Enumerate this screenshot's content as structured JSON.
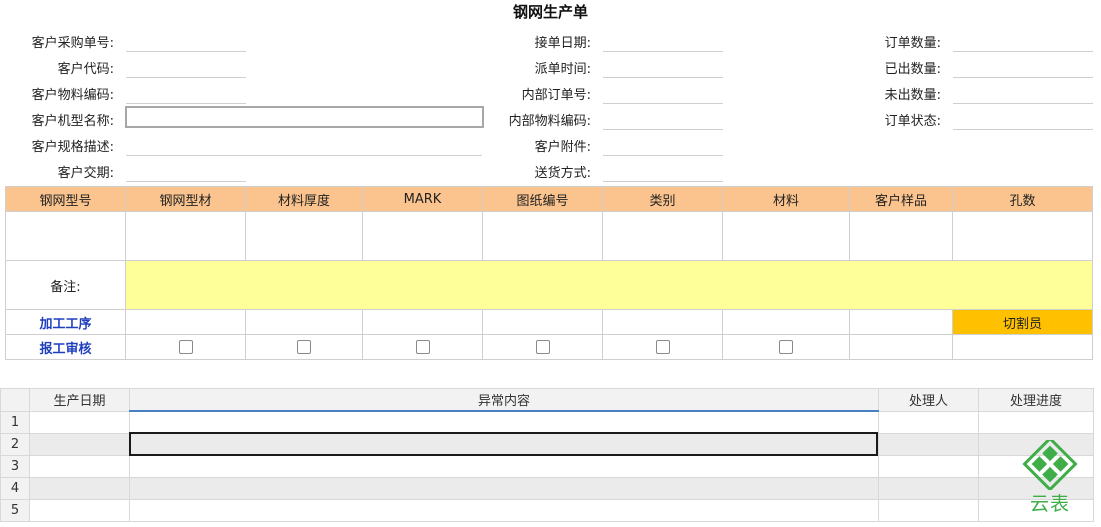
{
  "title": "钢网生产单",
  "form": {
    "left": [
      {
        "label": "客户采购单号:"
      },
      {
        "label": "客户代码:"
      },
      {
        "label": "客户物料编码:"
      },
      {
        "label": "客户机型名称:"
      },
      {
        "label": "客户规格描述:"
      },
      {
        "label": "客户交期:"
      }
    ],
    "middle": [
      {
        "label": "接单日期:"
      },
      {
        "label": "派单时间:"
      },
      {
        "label": "内部订单号:"
      },
      {
        "label": "内部物料编码:"
      },
      {
        "label": "客户附件:"
      },
      {
        "label": "送货方式:"
      }
    ],
    "right": [
      {
        "label": "订单数量:"
      },
      {
        "label": "已出数量:"
      },
      {
        "label": "未出数量:"
      },
      {
        "label": "订单状态:"
      }
    ]
  },
  "grid": {
    "headers": [
      "钢网型号",
      "钢网型材",
      "材料厚度",
      "MARK",
      "图纸编号",
      "类别",
      "材料",
      "客户样品",
      "孔数"
    ],
    "note_label": "备注:",
    "process_label": "加工工序",
    "process_role": "切割员",
    "audit_label": "报工审核"
  },
  "sheet": {
    "headers": [
      "生产日期",
      "异常内容",
      "处理人",
      "处理进度"
    ],
    "row_numbers": [
      "1",
      "2",
      "3",
      "4",
      "5"
    ]
  },
  "logo": {
    "text": "云表",
    "color": "#3fae49"
  },
  "colors": {
    "header_bg": "#fbc48e",
    "note_bg": "#ffff99",
    "cutter_bg": "#ffc000",
    "accent_blue": "#1f3fbf"
  }
}
